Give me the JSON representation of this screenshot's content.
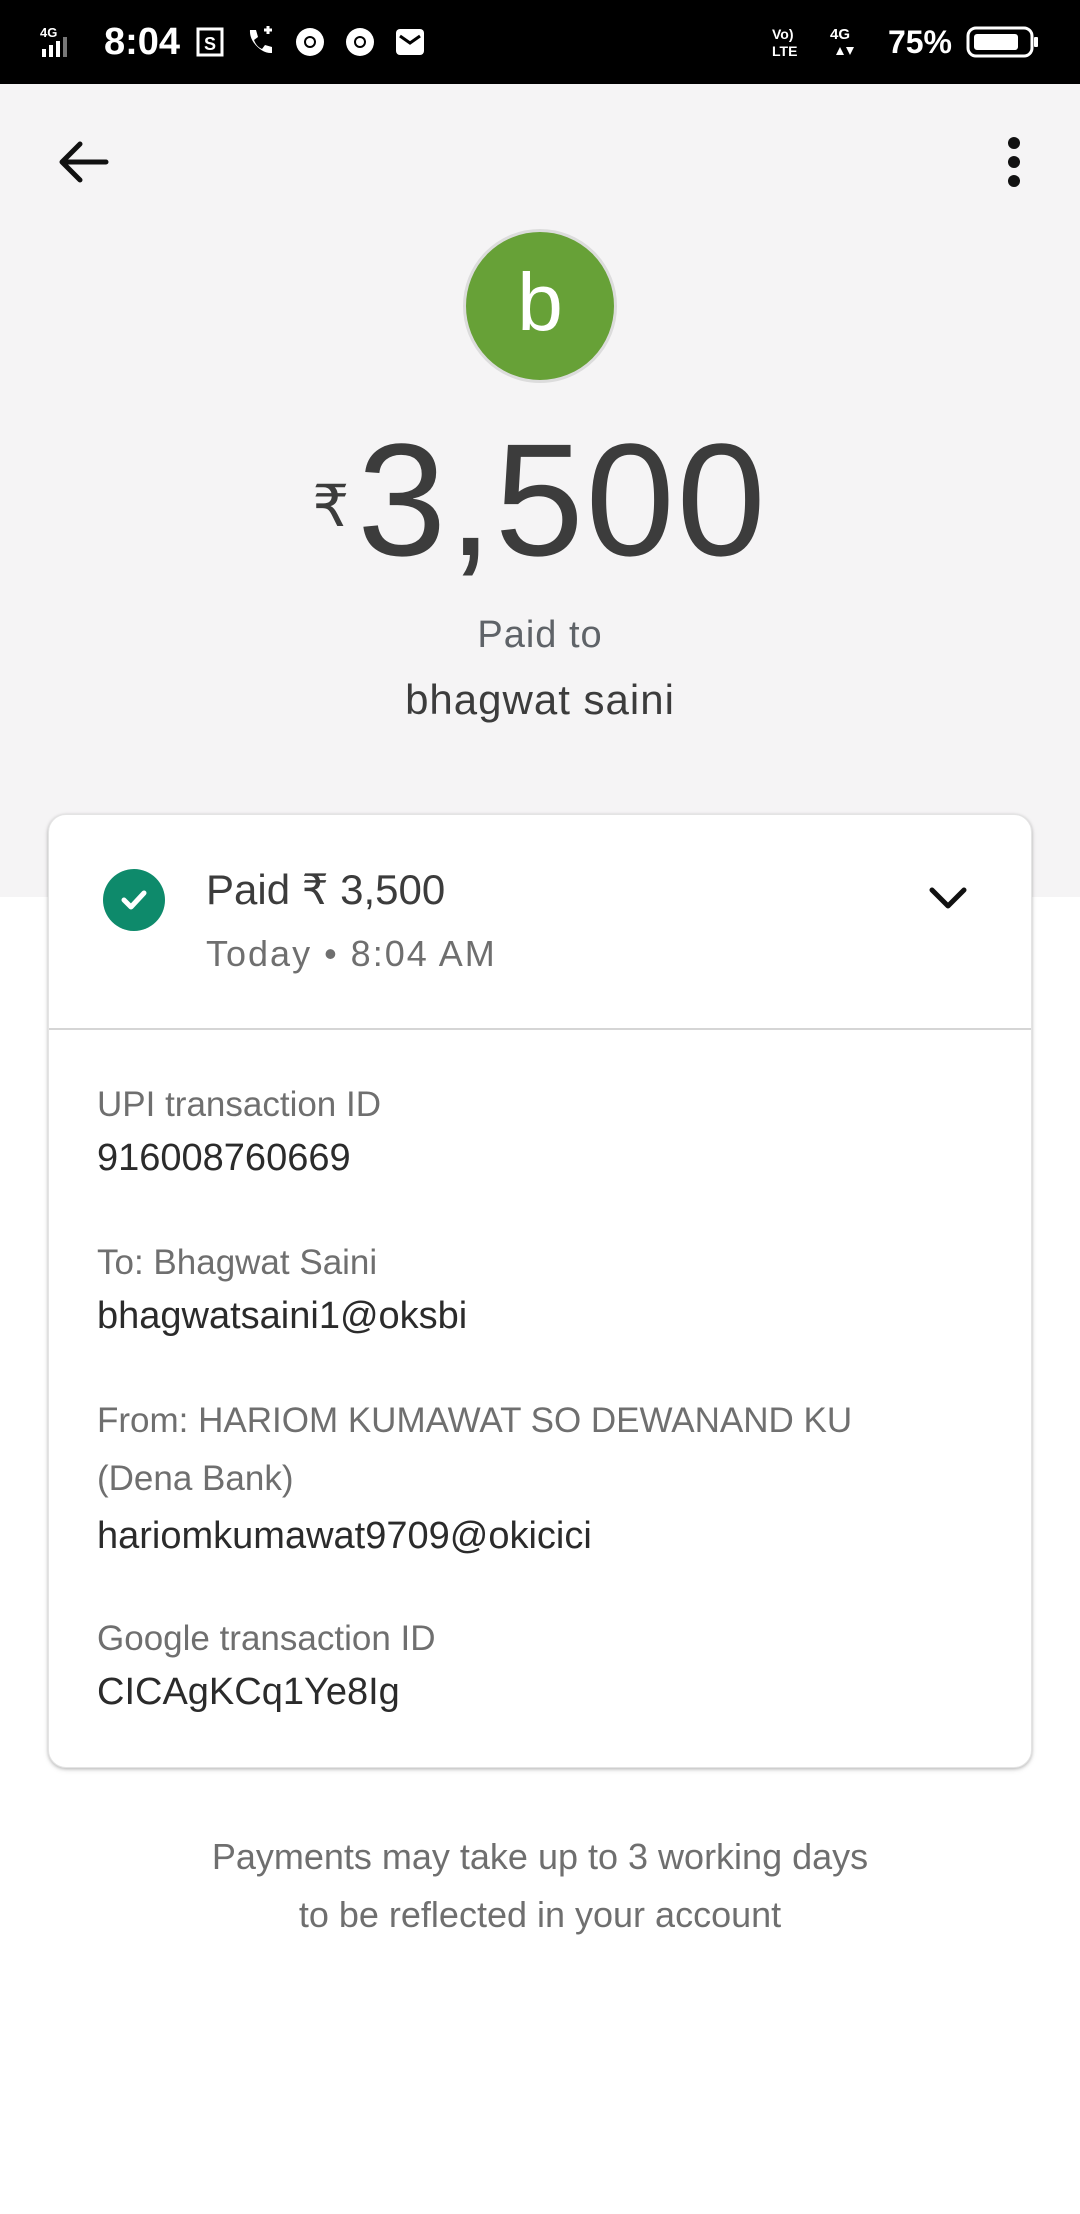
{
  "status_bar": {
    "network": "4G",
    "time": "8:04",
    "volte": "Vo) LTE",
    "network_right": "4G",
    "battery": "75%"
  },
  "header": {
    "avatar_letter": "b",
    "avatar_color": "#67a137",
    "currency": "₹",
    "amount": "3,500",
    "paid_to_label": "Paid to",
    "payee": "bhagwat saini"
  },
  "summary": {
    "title": "Paid ₹ 3,500",
    "subtitle": "Today • 8:04 AM",
    "status_color": "#0e8a6b"
  },
  "details": {
    "upi_label": "UPI transaction ID",
    "upi_value": "916008760669",
    "to_label": "To: Bhagwat  Saini",
    "to_value": "bhagwatsaini1@oksbi",
    "from_label_line1": "From: HARIOM KUMAWAT SO DEWANAND KU",
    "from_label_line2": "(Dena Bank)",
    "from_value": "hariomkumawat9709@okicici",
    "google_label": "Google transaction ID",
    "google_value": "CICAgKCq1Ye8Ig"
  },
  "footer": {
    "line1": "Payments may take up to 3 working days",
    "line2": "to be reflected in your account"
  },
  "icons": {
    "back": "arrow-back-icon",
    "more": "more-vert-icon",
    "check": "check-circle-icon",
    "expand": "chevron-down-icon"
  }
}
